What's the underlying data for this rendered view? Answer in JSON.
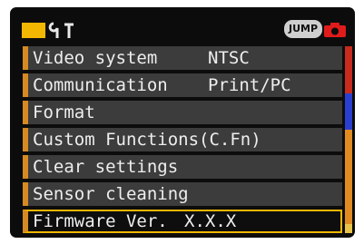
{
  "header": {
    "tab_icon": "settings-tab-icon",
    "tools_icon": "wrench-screwdriver-icon",
    "jump_label": "JUMP",
    "camera_icon": "camera-icon",
    "accent": "#f2b700",
    "camera_color": "#e01b1b"
  },
  "menu": {
    "items": [
      {
        "label": "Video system",
        "value": "NTSC"
      },
      {
        "label": "Communication",
        "value": "Print/PC"
      },
      {
        "label": "Format",
        "value": ""
      },
      {
        "label": "Custom Functions(C.Fn)",
        "value": ""
      },
      {
        "label": "Clear settings",
        "value": ""
      },
      {
        "label": "Sensor cleaning",
        "value": ""
      },
      {
        "label": "Firmware Ver.",
        "value": "X.X.X"
      }
    ],
    "selected_index": 6
  },
  "scrollbar": {
    "colors": [
      "#c62b1d",
      "#2a3fd0",
      "#e08a22",
      "#e8c34a"
    ]
  }
}
